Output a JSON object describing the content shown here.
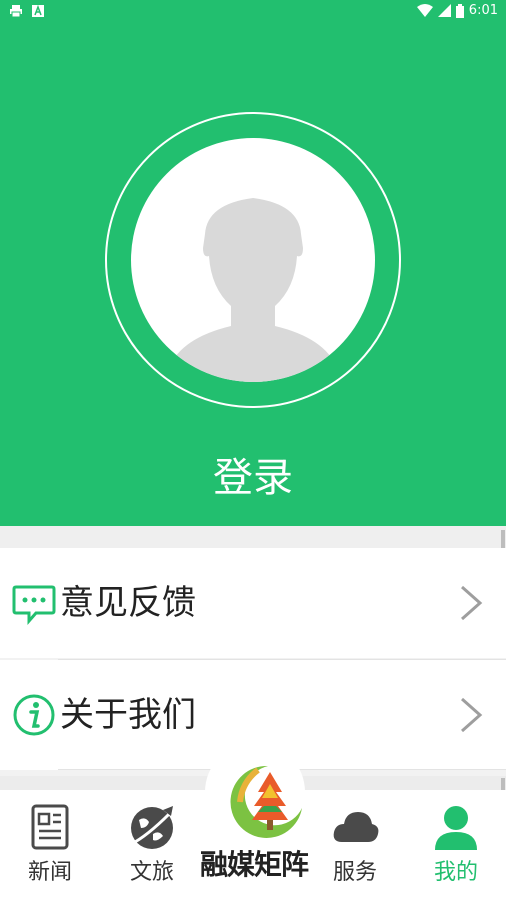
{
  "status_bar": {
    "time": "6:01"
  },
  "profile": {
    "login_label": "登录"
  },
  "menu": [
    {
      "label": "意见反馈",
      "icon": "feedback-icon"
    },
    {
      "label": "关于我们",
      "icon": "info-icon"
    }
  ],
  "tabs": [
    {
      "label": "新闻",
      "icon": "news-icon"
    },
    {
      "label": "文旅",
      "icon": "travel-icon"
    },
    {
      "label": "服务",
      "icon": "cloud-icon"
    },
    {
      "label": "我的",
      "icon": "user-icon"
    }
  ],
  "center_brand": {
    "text": "融媒矩阵",
    "icon": "tree-logo-icon"
  },
  "colors": {
    "brand_green": "#22bf6f",
    "active_tab": "#22bf6f"
  }
}
